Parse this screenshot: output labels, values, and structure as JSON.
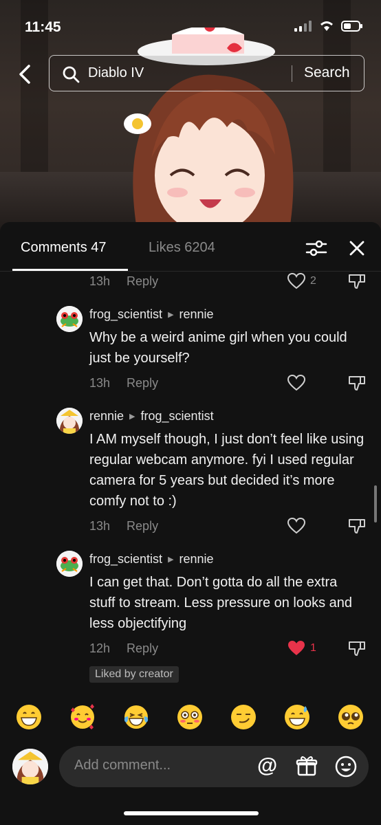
{
  "status_bar": {
    "time": "11:45"
  },
  "search": {
    "query": "Diablo IV",
    "button": "Search"
  },
  "tabs": {
    "comments": "Comments 47",
    "likes": "Likes 6204"
  },
  "comments": [
    {
      "meta_only": true,
      "time": "13h",
      "reply": "Reply",
      "likes": "2"
    },
    {
      "author": "frog_scientist",
      "reply_to": "rennie",
      "text": "Why be a weird anime girl when you could just be yourself?",
      "time": "13h",
      "reply": "Reply"
    },
    {
      "author": "rennie",
      "reply_to": "frog_scientist",
      "text": "I AM myself though, I just don’t feel like using regular webcam anymore. fyi I used regular camera for 5 years but decided it’s more comfy not to :)",
      "time": "13h",
      "reply": "Reply"
    },
    {
      "author": "frog_scientist",
      "reply_to": "rennie",
      "text": "I can get that. Don’t gotta do all the extra stuff to stream. Less pressure on looks and less objectifying",
      "time": "12h",
      "reply": "Reply",
      "likes": "1",
      "badge": "Liked by creator"
    }
  ],
  "emojis": [
    "grinning-face",
    "smiling-face-with-hearts",
    "face-with-tears-of-joy",
    "flushed-face",
    "smirking-face",
    "grinning-face-with-sweat",
    "pleading-face"
  ],
  "input": {
    "placeholder": "Add comment...",
    "at": "@"
  },
  "colors": {
    "background": "#121212",
    "liked_heart": "#e8334a",
    "muted_text": "#8a8a8a"
  }
}
